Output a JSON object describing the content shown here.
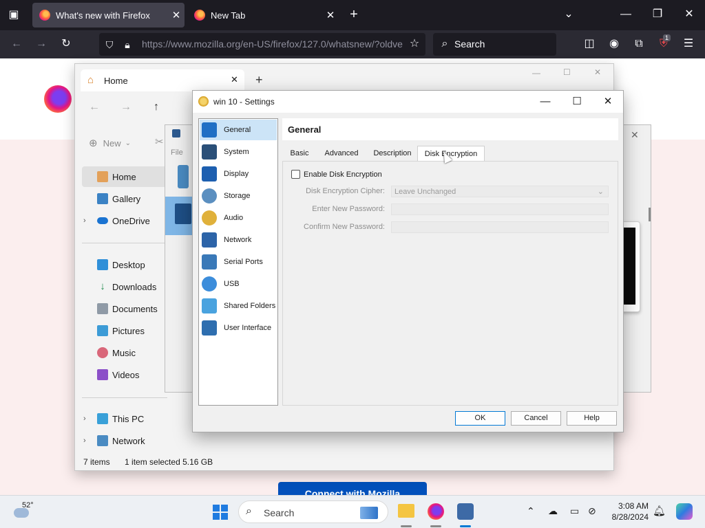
{
  "firefox": {
    "tabs": [
      {
        "title": "What's new with Firefox",
        "active": true
      },
      {
        "title": "New Tab",
        "active": false
      }
    ],
    "url": "https://www.mozilla.org/en-US/firefox/127.0/whatsnew/?oldve",
    "search_placeholder": "Search",
    "extension_badge": "1"
  },
  "page": {
    "connect_button": "Connect with Mozilla"
  },
  "explorer": {
    "tab_title": "Home",
    "new_button": "New",
    "file_menu": "File",
    "sidebar": [
      {
        "label": "Home",
        "icon": "home-icon",
        "selected": true,
        "expandable": false
      },
      {
        "label": "Gallery",
        "icon": "gallery-icon",
        "selected": false,
        "expandable": false
      },
      {
        "label": "OneDrive",
        "icon": "cloud-icon",
        "selected": false,
        "expandable": true
      },
      {
        "label": "Desktop",
        "icon": "desktop-icon",
        "selected": false,
        "expandable": false
      },
      {
        "label": "Downloads",
        "icon": "download-icon",
        "selected": false,
        "expandable": false
      },
      {
        "label": "Documents",
        "icon": "document-icon",
        "selected": false,
        "expandable": false
      },
      {
        "label": "Pictures",
        "icon": "pictures-icon",
        "selected": false,
        "expandable": false
      },
      {
        "label": "Music",
        "icon": "music-icon",
        "selected": false,
        "expandable": false
      },
      {
        "label": "Videos",
        "icon": "videos-icon",
        "selected": false,
        "expandable": false
      },
      {
        "label": "This PC",
        "icon": "pc-icon",
        "selected": false,
        "expandable": true
      },
      {
        "label": "Network",
        "icon": "network-icon",
        "selected": false,
        "expandable": true
      }
    ],
    "status_items": "7 items",
    "status_selected": "1 item selected  5.16 GB"
  },
  "vbox": {
    "title": "win 10 - Settings",
    "categories": [
      {
        "label": "General",
        "selected": true
      },
      {
        "label": "System",
        "selected": false
      },
      {
        "label": "Display",
        "selected": false
      },
      {
        "label": "Storage",
        "selected": false
      },
      {
        "label": "Audio",
        "selected": false
      },
      {
        "label": "Network",
        "selected": false
      },
      {
        "label": "Serial Ports",
        "selected": false
      },
      {
        "label": "USB",
        "selected": false
      },
      {
        "label": "Shared Folders",
        "selected": false
      },
      {
        "label": "User Interface",
        "selected": false
      }
    ],
    "section_title": "General",
    "tabs": [
      "Basic",
      "Advanced",
      "Description",
      "Disk Encryption"
    ],
    "active_tab": "Disk Encryption",
    "enable_encryption_label": "Enable Disk Encryption",
    "enable_encryption_checked": false,
    "cipher_label": "Disk Encryption Cipher:",
    "cipher_value": "Leave Unchanged",
    "new_password_label": "Enter New Password:",
    "confirm_password_label": "Confirm New Password:",
    "buttons": {
      "ok": "OK",
      "cancel": "Cancel",
      "help": "Help"
    }
  },
  "taskbar": {
    "weather_temp": "52°",
    "search_placeholder": "Search",
    "time": "3:08 AM",
    "date": "8/28/2024"
  },
  "colors": {
    "firefox_tabbar": "#1c1b22",
    "firefox_navbar": "#2b2a33",
    "selection_blue": "#cce4f7",
    "accent_blue": "#0078d4"
  }
}
